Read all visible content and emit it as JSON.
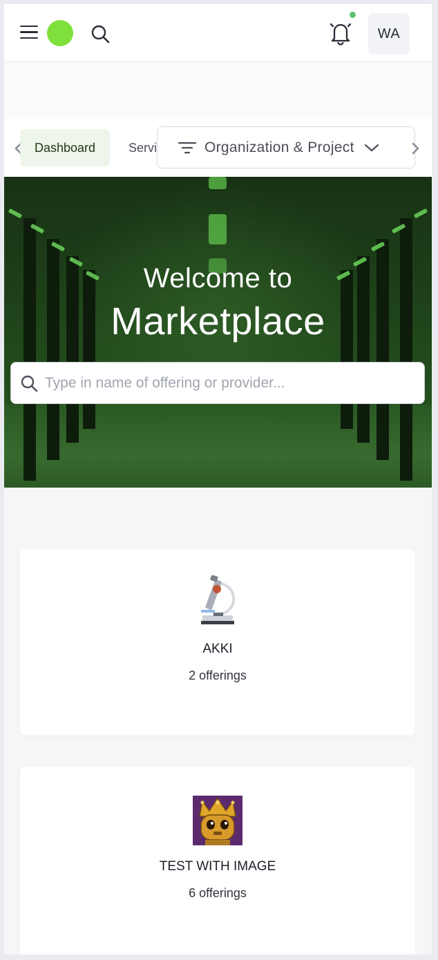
{
  "header": {
    "menu_icon": "hamburger-menu-icon",
    "logo_color": "#80e03b",
    "search_icon": "search-icon",
    "notification_icon": "bell-icon",
    "notification_dot_color": "#5cc36e",
    "avatar_initials": "WA"
  },
  "tabs": {
    "items": [
      {
        "label": "Dashboard",
        "active": true
      },
      {
        "label": "Services",
        "active": false
      }
    ],
    "org_project_selector": "Organization & Project"
  },
  "hero": {
    "title_line1": "Welcome to",
    "title_line2": "Marketplace",
    "search_placeholder": "Type in name of offering or provider...",
    "search_value": ""
  },
  "providers": [
    {
      "name": "AKKI",
      "offerings": "2 offerings",
      "icon": "microscope-icon"
    },
    {
      "name": "TEST WITH IMAGE",
      "offerings": "6 offerings",
      "icon": "crowned-robot-image"
    }
  ],
  "colors": {
    "active_tab_bg": "#eef5ea",
    "hero_green": "#244f1d"
  }
}
